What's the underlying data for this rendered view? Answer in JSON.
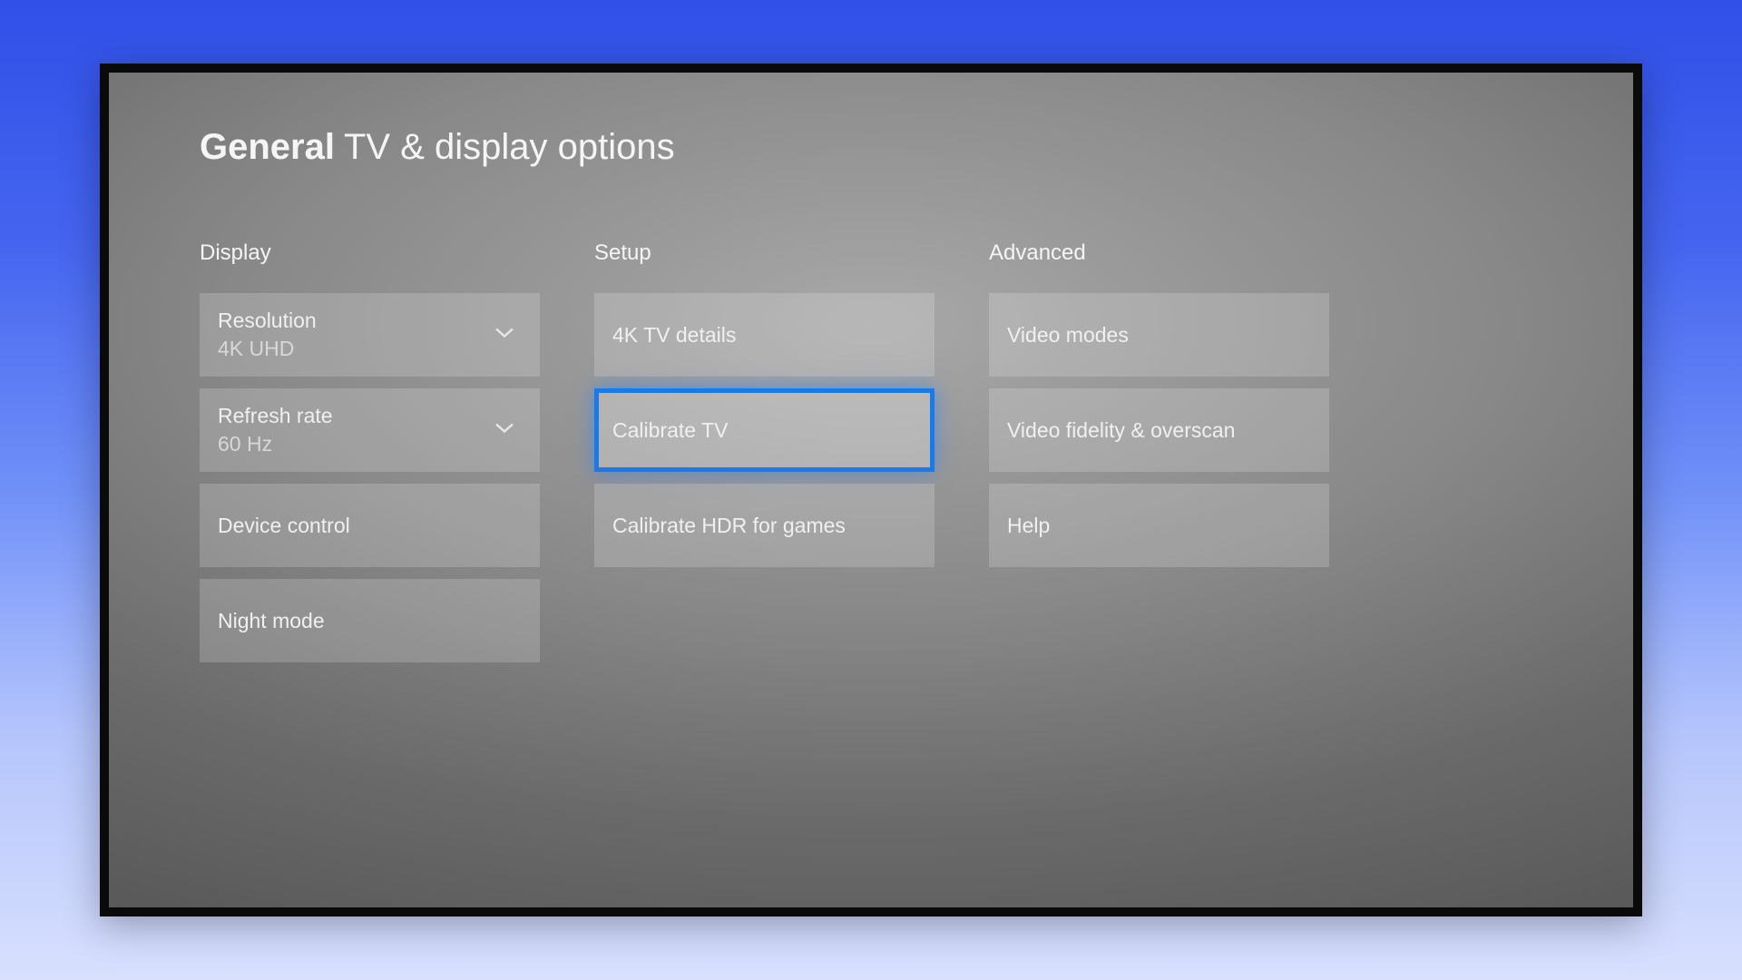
{
  "breadcrumb": {
    "section": "General",
    "page": "TV & display options"
  },
  "columns": {
    "display": {
      "header": "Display",
      "items": {
        "resolution": {
          "label": "Resolution",
          "value": "4K UHD"
        },
        "refresh_rate": {
          "label": "Refresh rate",
          "value": "60 Hz"
        },
        "device_control": {
          "label": "Device control"
        },
        "night_mode": {
          "label": "Night mode"
        }
      }
    },
    "setup": {
      "header": "Setup",
      "items": {
        "details_4k": {
          "label": "4K TV details"
        },
        "calibrate_tv": {
          "label": "Calibrate TV"
        },
        "calibrate_hdr": {
          "label": "Calibrate HDR for games"
        }
      }
    },
    "advanced": {
      "header": "Advanced",
      "items": {
        "video_modes": {
          "label": "Video modes"
        },
        "fidelity_overscan": {
          "label": "Video fidelity & overscan"
        },
        "help": {
          "label": "Help"
        }
      }
    }
  }
}
